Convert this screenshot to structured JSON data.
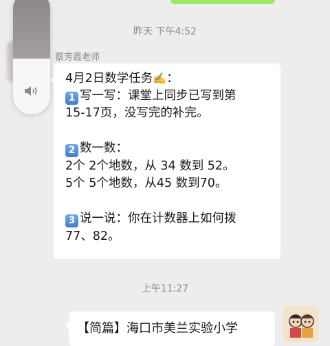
{
  "top_bubble": {
    "color": "#95ec69"
  },
  "timestamps": [
    "昨天 下午4:52",
    "上午11:27"
  ],
  "volume": {
    "level": 0.45,
    "icon": "speaker-icon"
  },
  "message1": {
    "sender": "蔡芳霞老师",
    "line1": "4月2日数学任务",
    "line1_emoji": "✍️",
    "line1_tail": "：",
    "item1_key": "1",
    "item1_a": "写一写：课堂上同步已写到第",
    "item1_b": "15-17页，没写完的补完。",
    "item2_key": "2",
    "item2_a": "数一数：",
    "item2_b": "2个 2个地数，从 34 数到 52。",
    "item2_c": "5个 5个地数，从45 数到70。",
    "item3_key": "3",
    "item3_a": "说一说：你在计数器上如何拨",
    "item3_b": "77、82。"
  },
  "message2": {
    "title": "【简篇】海口市美兰实验小学"
  }
}
